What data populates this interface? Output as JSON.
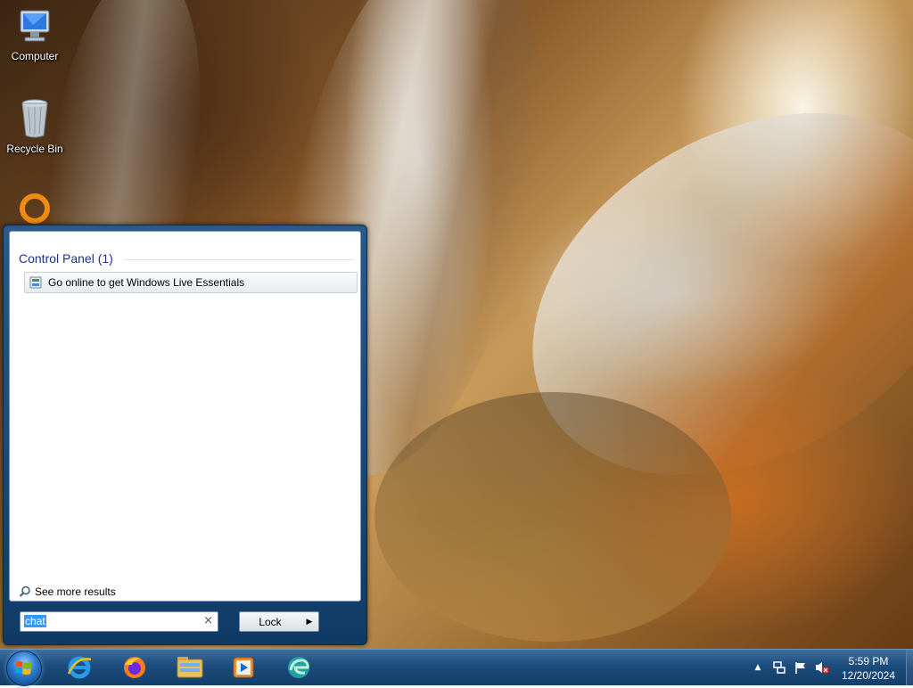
{
  "desktop": {
    "icons": [
      {
        "label": "Computer",
        "icon": "computer-icon"
      },
      {
        "label": "Recycle Bin",
        "icon": "recycle-bin-icon"
      },
      {
        "label": "",
        "icon": "orange-ring-app-icon"
      }
    ]
  },
  "start_menu": {
    "results_header": "Control Panel (1)",
    "result_item": "Go online to get Windows Live Essentials",
    "see_more": "See more results",
    "search_value": "chat",
    "clear_glyph": "×",
    "lock_label": "Lock",
    "lock_arrow": "▶"
  },
  "taskbar": {
    "pinned": [
      "start-orb",
      "internet-explorer-icon",
      "firefox-icon",
      "file-explorer-icon",
      "media-player-icon",
      "edge-icon"
    ],
    "tray": [
      "show-hidden-icons",
      "network-icon",
      "action-center-flag-icon",
      "volume-muted-icon"
    ],
    "clock": {
      "time": "5:59 PM",
      "date": "12/20/2024"
    }
  },
  "colors": {
    "taskbar_top": "#3e6e9c",
    "taskbar_bottom": "#123e6a",
    "header_text": "#1e3287",
    "selection": "#3399ff"
  }
}
